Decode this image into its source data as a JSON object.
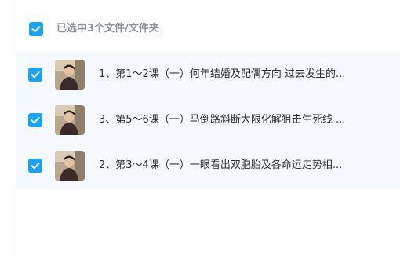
{
  "header": {
    "selection_label": "已选中3个文件/文件夹"
  },
  "files": [
    {
      "name": "1、第1～2课（一）何年结婚及配偶方向 过去发生的..."
    },
    {
      "name": "3、第5～6课（一）马倒路斜断大限化解狙击生死线 ..."
    },
    {
      "name": "2、第3～4课（一）一眼看出双胞胎及各命运走势相..."
    }
  ],
  "colors": {
    "accent": "#1aa3f2",
    "list_background": "#f5f8fc",
    "header_text": "#8a8f99",
    "item_text": "#2a2d33"
  },
  "icons": {
    "checkbox": "checkbox-checked-icon",
    "thumbnail": "video-thumbnail"
  }
}
